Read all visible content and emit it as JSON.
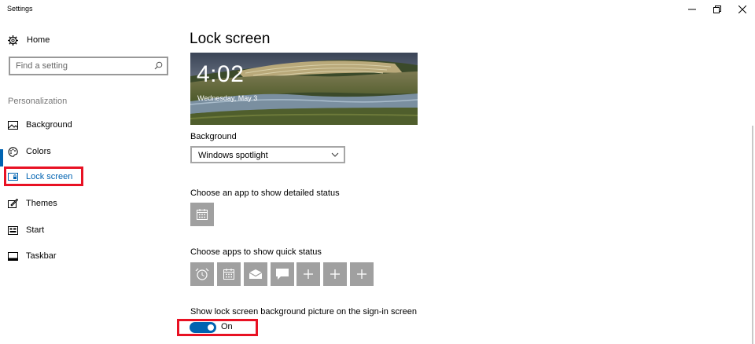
{
  "window": {
    "title": "Settings"
  },
  "sidebar": {
    "home_label": "Home",
    "search_placeholder": "Find a setting",
    "section_label": "Personalization",
    "items": [
      {
        "label": "Background",
        "icon": "picture-icon",
        "active": false
      },
      {
        "label": "Colors",
        "icon": "palette-icon",
        "active": false
      },
      {
        "label": "Lock screen",
        "icon": "lock-screen-icon",
        "active": true
      },
      {
        "label": "Themes",
        "icon": "themes-icon",
        "active": false
      },
      {
        "label": "Start",
        "icon": "start-icon",
        "active": false
      },
      {
        "label": "Taskbar",
        "icon": "taskbar-icon",
        "active": false
      }
    ]
  },
  "main": {
    "title": "Lock screen",
    "preview": {
      "time": "4:02",
      "date": "Wednesday, May 3"
    },
    "background_label": "Background",
    "background_value": "Windows spotlight",
    "detailed_status_label": "Choose an app to show detailed status",
    "detailed_status_app": "calendar-icon",
    "quick_status_label": "Choose apps to show quick status",
    "quick_status_apps": [
      "alarm-clock-icon",
      "calendar-icon",
      "mail-icon",
      "message-icon",
      "plus-icon",
      "plus-icon",
      "plus-icon"
    ],
    "signin_label": "Show lock screen background picture on the sign-in screen",
    "signin_toggle": {
      "state": "On",
      "on": true
    }
  },
  "colors": {
    "accent": "#0063b1",
    "highlight": "#e81123",
    "tile": "#a0a0a0"
  }
}
